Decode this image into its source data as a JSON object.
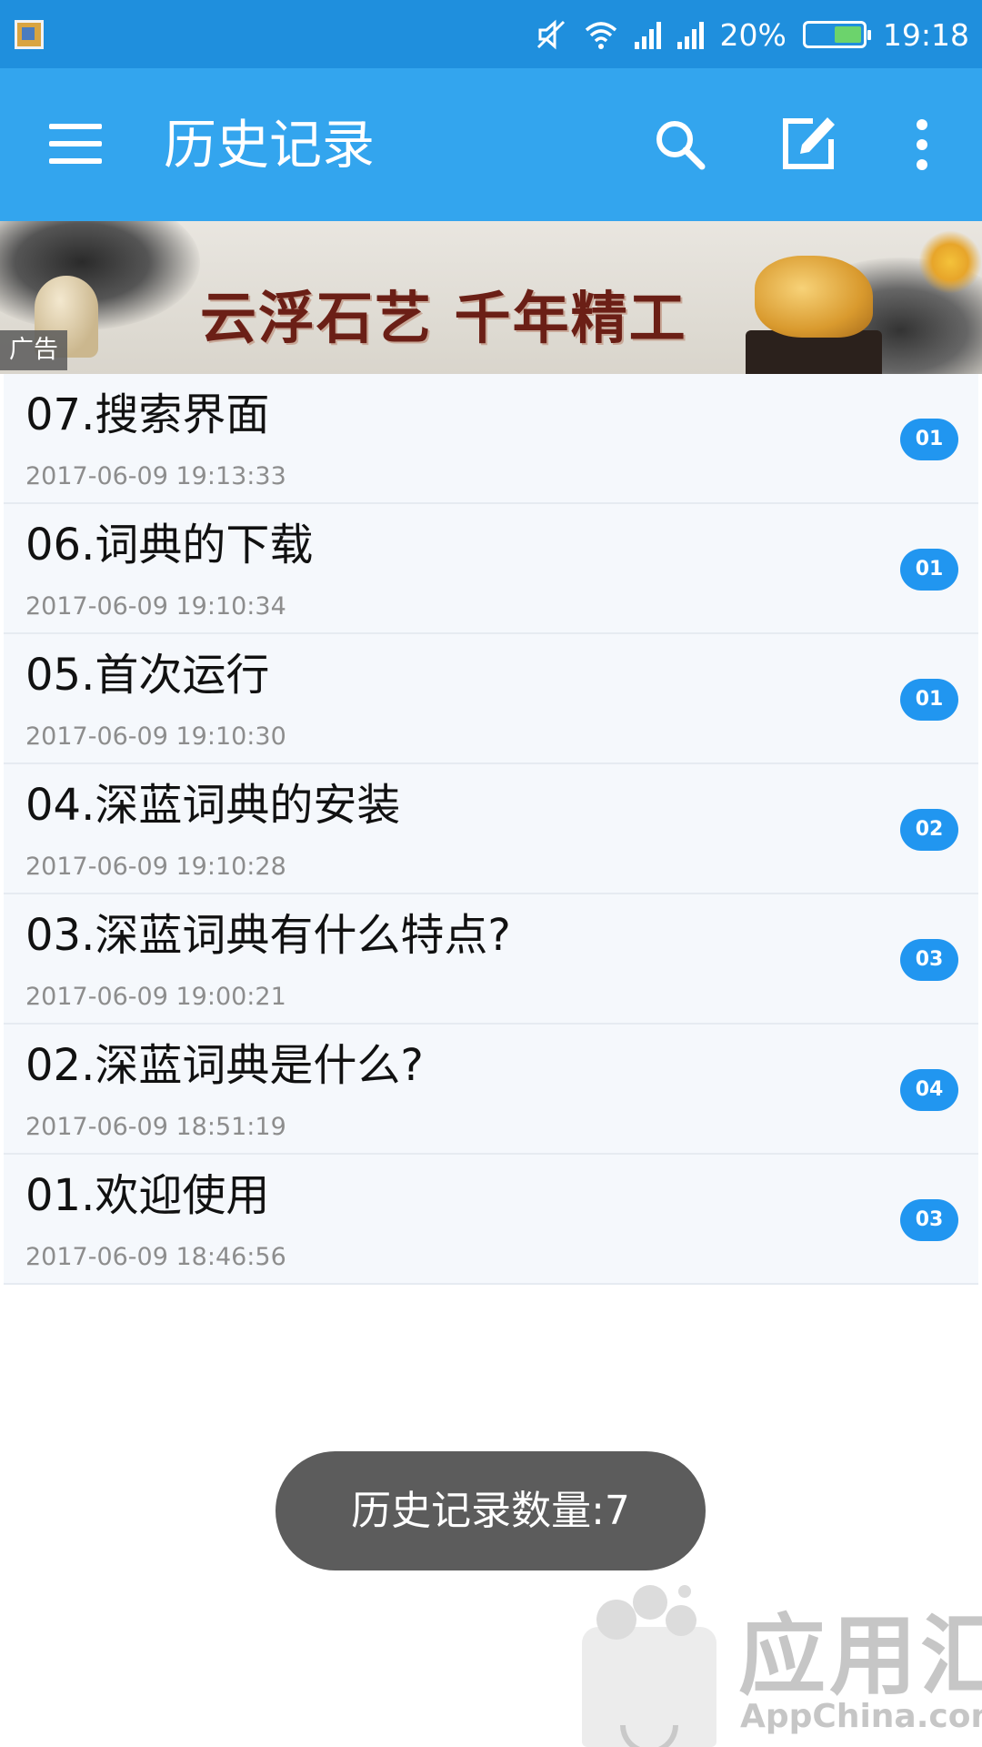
{
  "status_bar": {
    "battery": "20%",
    "time": "19:18",
    "icons": [
      "app-notification-icon",
      "mute-icon",
      "wifi-icon",
      "signal-icon",
      "signal-icon",
      "battery-icon"
    ]
  },
  "app_bar": {
    "title": "历史记录",
    "icons": [
      "menu-icon",
      "search-icon",
      "edit-icon",
      "more-vert-icon"
    ],
    "color": "#33a5ee"
  },
  "ad": {
    "slogan": "云浮石艺 千年精工",
    "tag": "广告"
  },
  "history": [
    {
      "title": "07.搜索界面",
      "time": "2017-06-09  19:13:33",
      "count": "01"
    },
    {
      "title": "06.词典的下载",
      "time": "2017-06-09  19:10:34",
      "count": "01"
    },
    {
      "title": "05.首次运行",
      "time": "2017-06-09  19:10:30",
      "count": "01"
    },
    {
      "title": "04.深蓝词典的安装",
      "time": "2017-06-09  19:10:28",
      "count": "02"
    },
    {
      "title": "03.深蓝词典有什么特点?",
      "time": "2017-06-09  19:00:21",
      "count": "03"
    },
    {
      "title": "02.深蓝词典是什么?",
      "time": "2017-06-09  18:51:19",
      "count": "04"
    },
    {
      "title": "01.欢迎使用",
      "time": "2017-06-09  18:46:56",
      "count": "03"
    }
  ],
  "toast": "历史记录数量:7",
  "watermark": {
    "name": "应用汇",
    "site": "AppChina.com"
  },
  "colors": {
    "status_bar": "#1f8fdd",
    "badge": "#2196f0",
    "toast": "#5c5c5c"
  }
}
